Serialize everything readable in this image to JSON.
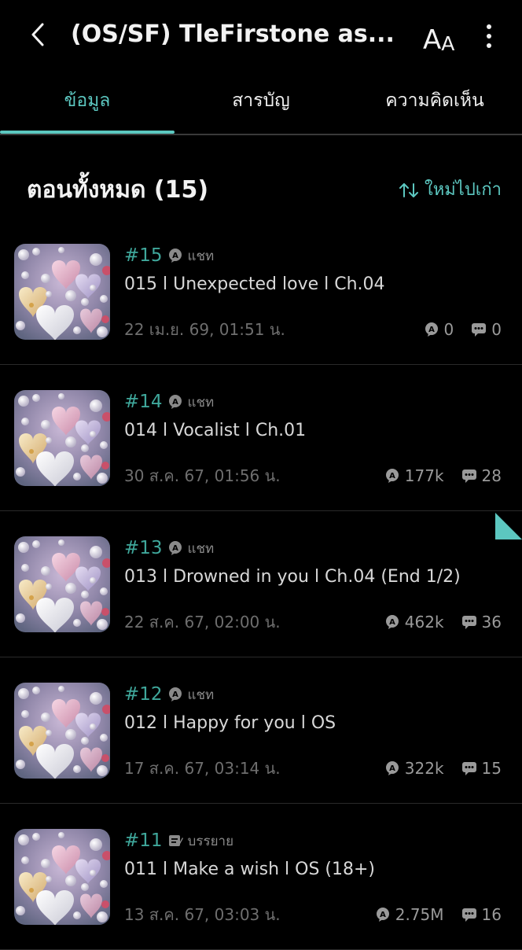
{
  "header": {
    "title": "(OS/SF) TleFirstone as...",
    "font_button_big": "A",
    "font_button_small": "A"
  },
  "tabs": [
    {
      "label": "ข้อมูล",
      "active": true
    },
    {
      "label": "สารบัญ",
      "active": false
    },
    {
      "label": "ความคิดเห็น",
      "active": false
    }
  ],
  "section": {
    "title": "ตอนทั้งหมด (15)",
    "sort_label": "ใหม่ไปเก่า"
  },
  "episodes": [
    {
      "number": "#15",
      "type": "แชท",
      "type_icon": "chat-type-icon",
      "title": "015 l Unexpected love l Ch.04",
      "date": "22 เม.ย. 69, 01:51 น.",
      "views": "0",
      "comments": "0"
    },
    {
      "number": "#14",
      "type": "แชท",
      "type_icon": "chat-type-icon",
      "title": "014 l Vocalist l Ch.01",
      "date": "30 ส.ค. 67, 01:56 น.",
      "views": "177k",
      "comments": "28"
    },
    {
      "number": "#13",
      "type": "แชท",
      "type_icon": "chat-type-icon",
      "title": "013 l Drowned in you l Ch.04 (End 1/2)",
      "date": "22 ส.ค. 67, 02:00 น.",
      "views": "462k",
      "comments": "36"
    },
    {
      "number": "#12",
      "type": "แชท",
      "type_icon": "chat-type-icon",
      "title": "012 l Happy for you l OS",
      "date": "17 ส.ค. 67, 03:14 น.",
      "views": "322k",
      "comments": "15"
    },
    {
      "number": "#11",
      "type": "บรรยาย",
      "type_icon": "narrative-type-icon",
      "title": "011 l Make a wish l OS (18+)",
      "date": "13 ส.ค. 67, 03:03 น.",
      "views": "2.75M",
      "comments": "16"
    }
  ],
  "colors": {
    "accent": "#5cc7c0",
    "episode_number": "#3fa79b",
    "background": "#000000"
  }
}
